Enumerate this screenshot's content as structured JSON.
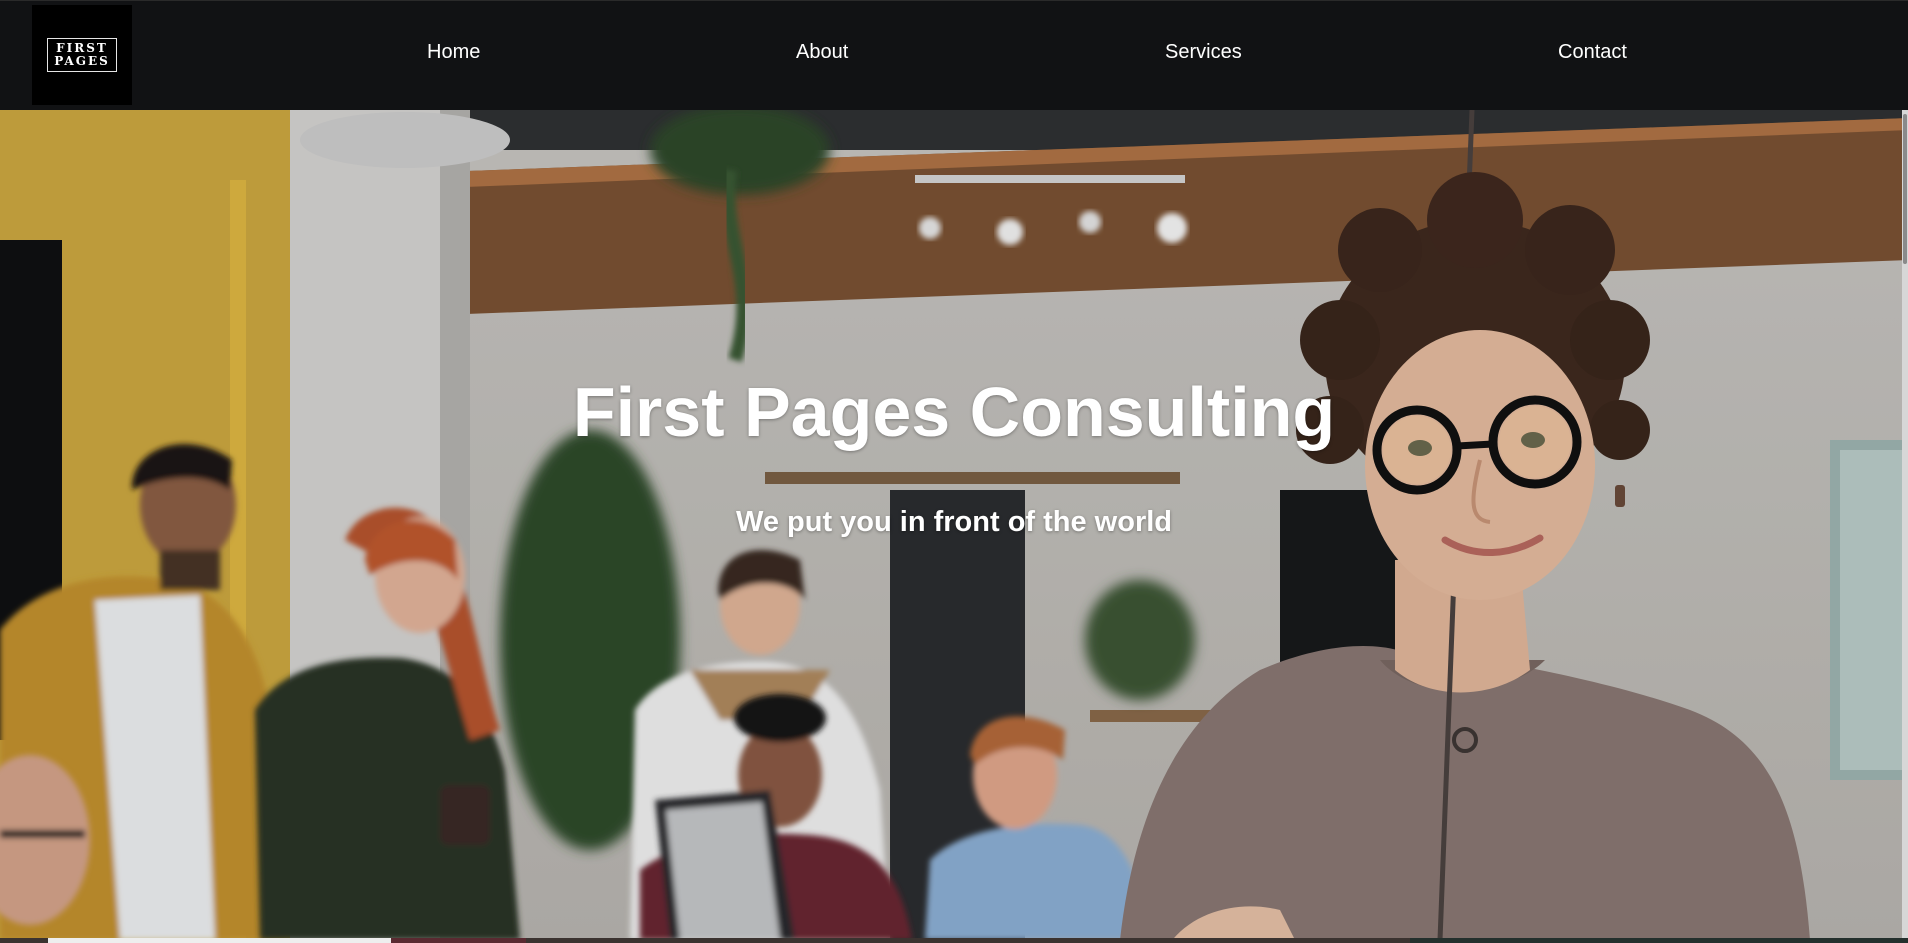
{
  "brand": {
    "logo_line1": "FIRST",
    "logo_line2": "PAGES"
  },
  "nav": {
    "items": [
      {
        "label": "Home"
      },
      {
        "label": "About"
      },
      {
        "label": "Services"
      },
      {
        "label": "Contact"
      }
    ]
  },
  "hero": {
    "title": "First Pages Consulting",
    "subtitle": "We put you in front of the world"
  },
  "colors": {
    "navbar_background": "#111214",
    "nav_text": "#ffffff",
    "hero_text": "#ffffff",
    "logo_background": "#000000"
  }
}
